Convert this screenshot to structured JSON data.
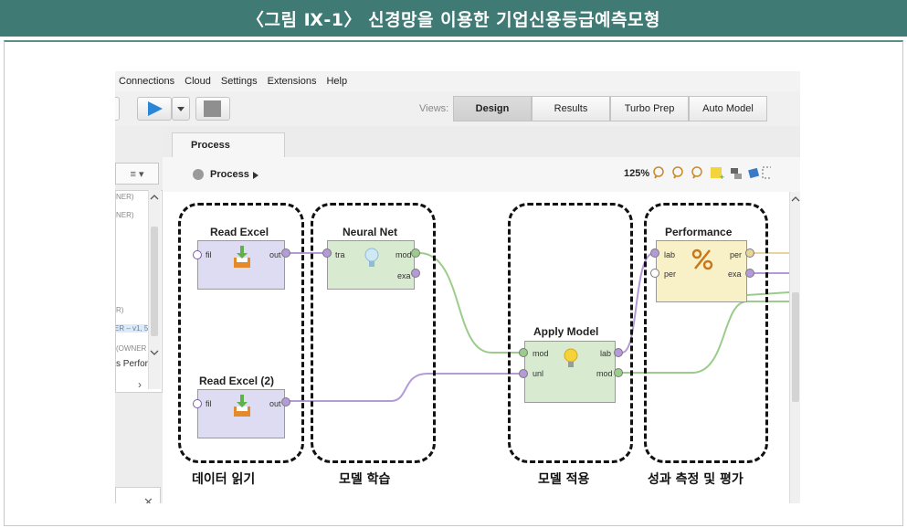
{
  "figure_title": "〈그림 Ⅸ-1〉 신경망을 이용한 기업신용등급예측모형",
  "menu": [
    "Connections",
    "Cloud",
    "Settings",
    "Extensions",
    "Help"
  ],
  "views_label": "Views:",
  "views": [
    "Design",
    "Results",
    "Turbo Prep",
    "Auto Model"
  ],
  "active_view": "Design",
  "process_tab": "Process",
  "breadcrumb": "Process",
  "zoom": "125%",
  "left_pane": {
    "combo": "≡ ▾",
    "items": [
      "NER)",
      "NER)",
      "R)",
      "ER – v1, 5",
      "(OWNER",
      "s Perfor"
    ],
    "nav_arrow": "›",
    "search_clear": "✕"
  },
  "operators": {
    "read_excel": {
      "title": "Read Excel",
      "ports_in": [
        "fil"
      ],
      "ports_out": [
        "out"
      ]
    },
    "read_excel_2": {
      "title": "Read Excel (2)",
      "ports_in": [
        "fil"
      ],
      "ports_out": [
        "out"
      ]
    },
    "neural_net": {
      "title": "Neural Net",
      "ports_in": [
        "tra"
      ],
      "ports_out": [
        "mod",
        "exa"
      ]
    },
    "apply_model": {
      "title": "Apply Model",
      "ports_in": [
        "mod",
        "unl"
      ],
      "ports_out": [
        "lab",
        "mod"
      ]
    },
    "performance": {
      "title": "Performance",
      "ports_in": [
        "lab",
        "per"
      ],
      "ports_out": [
        "per",
        "exa"
      ]
    }
  },
  "captions": [
    "데이터 읽기",
    "모델 학습",
    "모델 적용",
    "성과 측정 및 평가"
  ],
  "colors": {
    "header_bg": "#3f7a74",
    "read_op": "#dedcf2",
    "neural_op": "#d8ead0",
    "apply_op": "#d8ead0",
    "perf_op": "#f8f1c8",
    "wire_green": "#9ccc8c",
    "wire_purple": "#b49ad8",
    "wire_yellow": "#e8d59a"
  }
}
